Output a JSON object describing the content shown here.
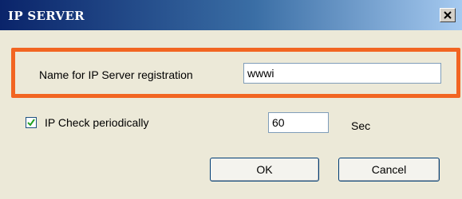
{
  "dialog": {
    "title": "IP SERVER",
    "close_glyph": "×",
    "close_icon": "close-icon"
  },
  "form": {
    "name_label": "Name for IP Server registration",
    "name_value": "wwwi",
    "check_label": "IP Check periodically",
    "check_checked": true,
    "interval_value": "60",
    "interval_unit": "Sec"
  },
  "buttons": {
    "ok_label": "OK",
    "cancel_label": "Cancel"
  },
  "colors": {
    "highlight": "#f26522",
    "title_bar_start": "#0a246a",
    "title_bar_end": "#a6caf0"
  }
}
